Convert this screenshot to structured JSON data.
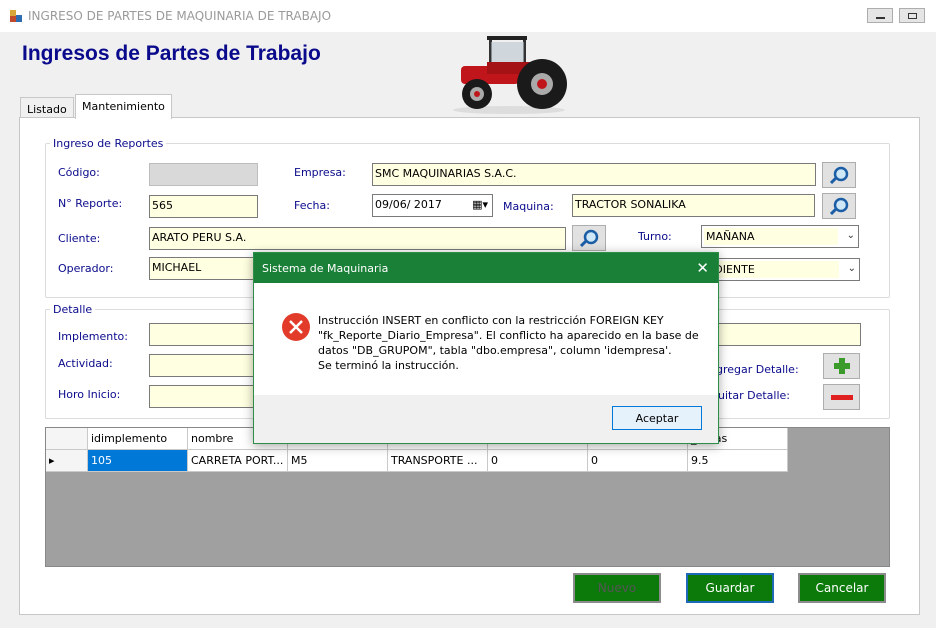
{
  "window": {
    "title": "INGRESO DE PARTES DE MAQUINARIA DE TRABAJO"
  },
  "form": {
    "title": "Ingresos de Partes de Trabajo"
  },
  "tabs": [
    {
      "label": "Listado"
    },
    {
      "label": "Mantenimiento"
    }
  ],
  "reportes": {
    "legend": "Ingreso de Reportes",
    "codigo_label": "Código:",
    "codigo_value": "",
    "empresa_label": "Empresa:",
    "empresa_value": "SMC MAQUINARIAS S.A.C.",
    "nreporte_label": "N° Reporte:",
    "nreporte_value": "565",
    "fecha_label": "Fecha:",
    "fecha_value": "09/06/ 2017",
    "maquina_label": "Maquina:",
    "maquina_value": "TRACTOR SONALIKA",
    "cliente_label": "Cliente:",
    "cliente_value": "ARATO PERU S.A.",
    "turno_label": "Turno:",
    "turno_value": "MAÑANA",
    "operador_label": "Operador:",
    "operador_value": "MICHAEL",
    "estado_value": "NDIENTE"
  },
  "detalle": {
    "legend": "Detalle",
    "implemento_label": "Implemento:",
    "actividad_label": "Actividad:",
    "horoinicio_label": "Horo Inicio:",
    "agregar_label": "gregar Detalle:",
    "quitar_label": "uitar Detalle:"
  },
  "grid": {
    "headers": [
      "idimplemento",
      "nombre",
      "",
      "",
      "",
      "",
      "_horas"
    ],
    "row": [
      "105",
      "CARRETA PORT...",
      "M5",
      "TRANSPORTE ...",
      "0",
      "0",
      "9.5"
    ]
  },
  "buttons": {
    "nuevo": "Nuevo",
    "guardar": "Guardar",
    "cancelar": "Cancelar"
  },
  "dialog": {
    "title": "Sistema de Maquinaria",
    "line1": "Instrucción INSERT en conflicto con la restricción FOREIGN KEY",
    "line2": "\"fk_Reporte_Diario_Empresa\". El conflicto ha aparecido en la base de",
    "line3": "datos \"DB_GRUPOM\", tabla \"dbo.empresa\", column 'idempresa'.",
    "line4": "Se terminó la instrucción.",
    "accept": "Aceptar"
  },
  "colors": {
    "accent_green": "#0b7a0b",
    "dialog_green": "#1a7f37",
    "label_blue": "#0a0a8c",
    "field_yellow": "#ffffe1"
  },
  "icons": [
    "search-icon",
    "plus-icon",
    "minus-icon",
    "error-icon",
    "calendar-icon",
    "tractor-icon"
  ]
}
